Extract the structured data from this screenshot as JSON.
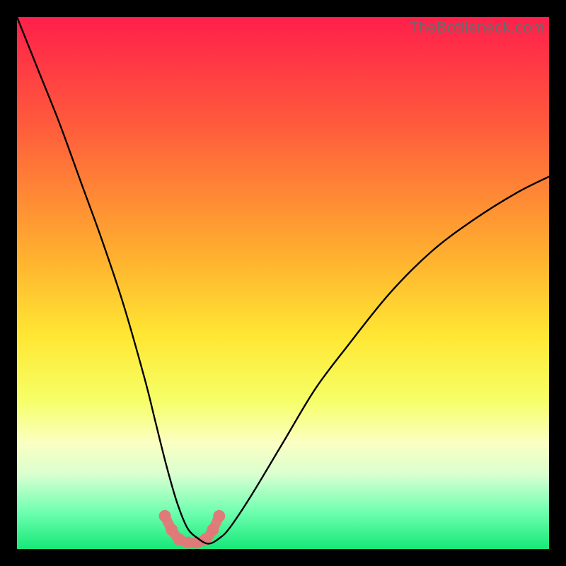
{
  "watermark": "TheBottleneck.com",
  "chart_data": {
    "type": "line",
    "title": "",
    "xlabel": "",
    "ylabel": "",
    "xlim": [
      0,
      100
    ],
    "ylim": [
      0,
      100
    ],
    "grid": false,
    "legend": false,
    "gradient_stops": [
      {
        "offset": 0,
        "color": "#ff1f4b"
      },
      {
        "offset": 0.2,
        "color": "#ff5a3c"
      },
      {
        "offset": 0.45,
        "color": "#ffb02f"
      },
      {
        "offset": 0.6,
        "color": "#ffe733"
      },
      {
        "offset": 0.72,
        "color": "#f6ff66"
      },
      {
        "offset": 0.8,
        "color": "#fbffc2"
      },
      {
        "offset": 0.86,
        "color": "#d9ffd0"
      },
      {
        "offset": 0.93,
        "color": "#6fffb0"
      },
      {
        "offset": 1.0,
        "color": "#17e878"
      }
    ],
    "series": [
      {
        "name": "bottleneck-curve",
        "color": "#000000",
        "x": [
          0,
          4,
          8,
          12,
          16,
          20,
          24,
          26,
          28,
          30,
          32,
          34,
          36,
          38,
          40,
          44,
          50,
          56,
          62,
          70,
          78,
          86,
          94,
          100
        ],
        "y": [
          100,
          90,
          80,
          69,
          58,
          46,
          32,
          24,
          16,
          9,
          4,
          2,
          1,
          2,
          4,
          10,
          20,
          30,
          38,
          48,
          56,
          62,
          67,
          70
        ]
      }
    ],
    "bottom_marks": {
      "color": "#e07a78",
      "points_x": [
        27.8,
        29.1,
        30.5,
        32.2,
        33.8,
        35.4,
        36.8,
        38.0
      ],
      "points_y": [
        6.2,
        3.6,
        1.8,
        1.2,
        1.2,
        1.8,
        3.6,
        6.2
      ]
    }
  }
}
